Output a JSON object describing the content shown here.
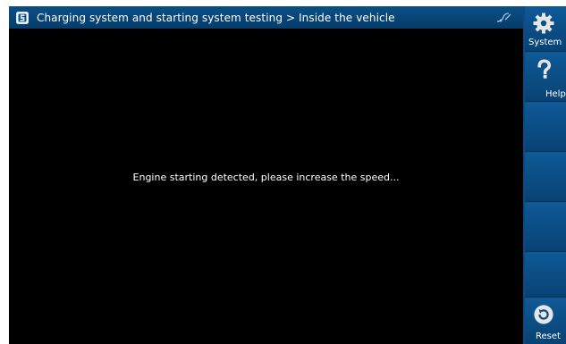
{
  "header": {
    "title": "Charging system and starting system testing > Inside the vehicle",
    "app_icon": "app-logo-icon",
    "status_icon": "connection-icon"
  },
  "main": {
    "message": "Engine starting detected, please increase the speed..."
  },
  "sidebar": {
    "items": [
      {
        "label": "System",
        "icon": "gear-icon"
      },
      {
        "label": "Help",
        "icon": "question-icon"
      },
      {
        "label": ""
      },
      {
        "label": ""
      },
      {
        "label": ""
      },
      {
        "label": ""
      },
      {
        "label": "Reset",
        "icon": "reset-icon"
      }
    ]
  },
  "colors": {
    "titlebar": "#0b4f87",
    "sidebar": "#0a4a80",
    "screen": "#000000",
    "text": "#ffffff"
  }
}
